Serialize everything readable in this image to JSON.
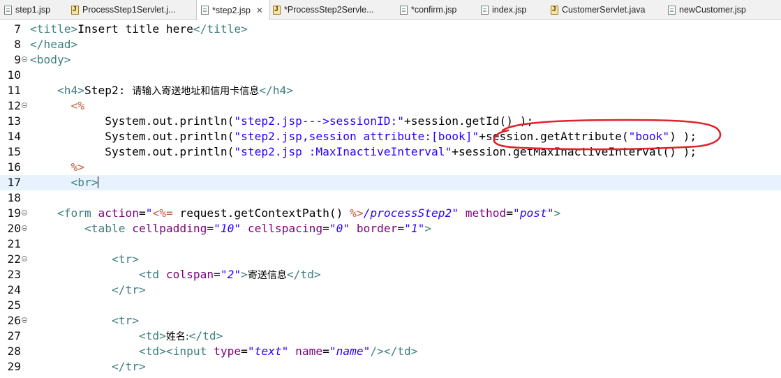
{
  "tabs": [
    {
      "label": "step1.jsp",
      "icon": "jsp-file-icon"
    },
    {
      "label": "ProcessStep1Servlet.j...",
      "icon": "java-file-icon"
    },
    {
      "label": "*step2.jsp",
      "icon": "jsp-file-icon",
      "active": true,
      "close": "✕"
    },
    {
      "label": "*ProcessStep2Servle...",
      "icon": "java-file-icon"
    },
    {
      "label": "*confirm.jsp",
      "icon": "jsp-file-icon"
    },
    {
      "label": "index.jsp",
      "icon": "jsp-file-icon"
    },
    {
      "label": "CustomerServlet.java",
      "icon": "java-file-icon"
    },
    {
      "label": "newCustomer.jsp",
      "icon": "jsp-file-icon"
    }
  ],
  "editor": {
    "current_line": "17",
    "lines": [
      {
        "n": "7",
        "fold": false,
        "segs": [
          [
            "t",
            "<title>"
          ],
          [
            "k",
            "Insert title here"
          ],
          [
            "t",
            "</title>"
          ]
        ]
      },
      {
        "n": "8",
        "fold": false,
        "segs": [
          [
            "t",
            "</head>"
          ]
        ]
      },
      {
        "n": "9",
        "fold": true,
        "segs": [
          [
            "t",
            "<body>"
          ]
        ]
      },
      {
        "n": "10",
        "fold": false,
        "segs": []
      },
      {
        "n": "11",
        "fold": false,
        "segs": [
          [
            "k",
            "    "
          ],
          [
            "t",
            "<h4>"
          ],
          [
            "k",
            "Step2: "
          ],
          [
            "cjk",
            "请输入寄送地址和信用卡信息"
          ],
          [
            "t",
            "</h4>"
          ]
        ]
      },
      {
        "n": "12",
        "fold": true,
        "segs": [
          [
            "k",
            "      "
          ],
          [
            "d",
            "<%"
          ]
        ]
      },
      {
        "n": "13",
        "fold": false,
        "segs": [
          [
            "k",
            "           System.out.println("
          ],
          [
            "s",
            "\"step2.jsp--->sessionID:\""
          ],
          [
            "k",
            "+session.getId() );"
          ]
        ]
      },
      {
        "n": "14",
        "fold": false,
        "segs": [
          [
            "k",
            "           System.out.println("
          ],
          [
            "s",
            "\"step2.jsp,session attribute:[book]\""
          ],
          [
            "k",
            "+session.getAttribute("
          ],
          [
            "s",
            "\"book\""
          ],
          [
            "k",
            ") );"
          ]
        ]
      },
      {
        "n": "15",
        "fold": false,
        "segs": [
          [
            "k",
            "           System.out.println("
          ],
          [
            "s",
            "\"step2.jsp :MaxInactiveInterval\""
          ],
          [
            "k",
            "+session.getMaxInactiveInterval() );"
          ]
        ]
      },
      {
        "n": "16",
        "fold": false,
        "segs": [
          [
            "k",
            "      "
          ],
          [
            "d",
            "%>"
          ]
        ]
      },
      {
        "n": "17",
        "fold": false,
        "cur": true,
        "segs": [
          [
            "k",
            "      "
          ],
          [
            "t",
            "<br>"
          ],
          [
            "caret",
            ""
          ]
        ]
      },
      {
        "n": "18",
        "fold": false,
        "segs": []
      },
      {
        "n": "19",
        "fold": true,
        "segs": [
          [
            "k",
            "    "
          ],
          [
            "t",
            "<form "
          ],
          [
            "a",
            "action"
          ],
          [
            "k",
            "="
          ],
          [
            "v",
            "\""
          ],
          [
            "d",
            "<%="
          ],
          [
            "k",
            " request.getContextPath() "
          ],
          [
            "d",
            "%>"
          ],
          [
            "v",
            "/processStep2\""
          ],
          [
            "k",
            " "
          ],
          [
            "a",
            "method"
          ],
          [
            "k",
            "="
          ],
          [
            "v",
            "\"post\""
          ],
          [
            "t",
            ">"
          ]
        ]
      },
      {
        "n": "20",
        "fold": true,
        "segs": [
          [
            "k",
            "        "
          ],
          [
            "t",
            "<table "
          ],
          [
            "a",
            "cellpadding"
          ],
          [
            "k",
            "="
          ],
          [
            "v",
            "\"10\""
          ],
          [
            "k",
            " "
          ],
          [
            "a",
            "cellspacing"
          ],
          [
            "k",
            "="
          ],
          [
            "v",
            "\"0\""
          ],
          [
            "k",
            " "
          ],
          [
            "a",
            "border"
          ],
          [
            "k",
            "="
          ],
          [
            "v",
            "\"1\""
          ],
          [
            "t",
            ">"
          ]
        ]
      },
      {
        "n": "21",
        "fold": false,
        "segs": []
      },
      {
        "n": "22",
        "fold": true,
        "segs": [
          [
            "k",
            "            "
          ],
          [
            "t",
            "<tr>"
          ]
        ]
      },
      {
        "n": "23",
        "fold": false,
        "segs": [
          [
            "k",
            "                "
          ],
          [
            "t",
            "<td "
          ],
          [
            "a",
            "colspan"
          ],
          [
            "k",
            "="
          ],
          [
            "v",
            "\"2\""
          ],
          [
            "t",
            ">"
          ],
          [
            "cjk",
            "寄送信息"
          ],
          [
            "t",
            "</td>"
          ]
        ]
      },
      {
        "n": "24",
        "fold": false,
        "segs": [
          [
            "k",
            "            "
          ],
          [
            "t",
            "</tr>"
          ]
        ]
      },
      {
        "n": "25",
        "fold": false,
        "segs": []
      },
      {
        "n": "26",
        "fold": true,
        "segs": [
          [
            "k",
            "            "
          ],
          [
            "t",
            "<tr>"
          ]
        ]
      },
      {
        "n": "27",
        "fold": false,
        "segs": [
          [
            "k",
            "                "
          ],
          [
            "t",
            "<td>"
          ],
          [
            "cjk",
            "姓名:"
          ],
          [
            "t",
            "</td>"
          ]
        ]
      },
      {
        "n": "28",
        "fold": false,
        "segs": [
          [
            "k",
            "                "
          ],
          [
            "t",
            "<td><input "
          ],
          [
            "a",
            "type"
          ],
          [
            "k",
            "="
          ],
          [
            "v",
            "\"text\""
          ],
          [
            "k",
            " "
          ],
          [
            "a",
            "name"
          ],
          [
            "k",
            "="
          ],
          [
            "v",
            "\"name\""
          ],
          [
            "t",
            "/></td>"
          ]
        ]
      },
      {
        "n": "29",
        "fold": false,
        "segs": [
          [
            "k",
            "            "
          ],
          [
            "t",
            "</tr>"
          ]
        ]
      }
    ]
  },
  "annotation": {
    "color": "#e0222a",
    "shape": "hand-drawn-ellipse"
  }
}
